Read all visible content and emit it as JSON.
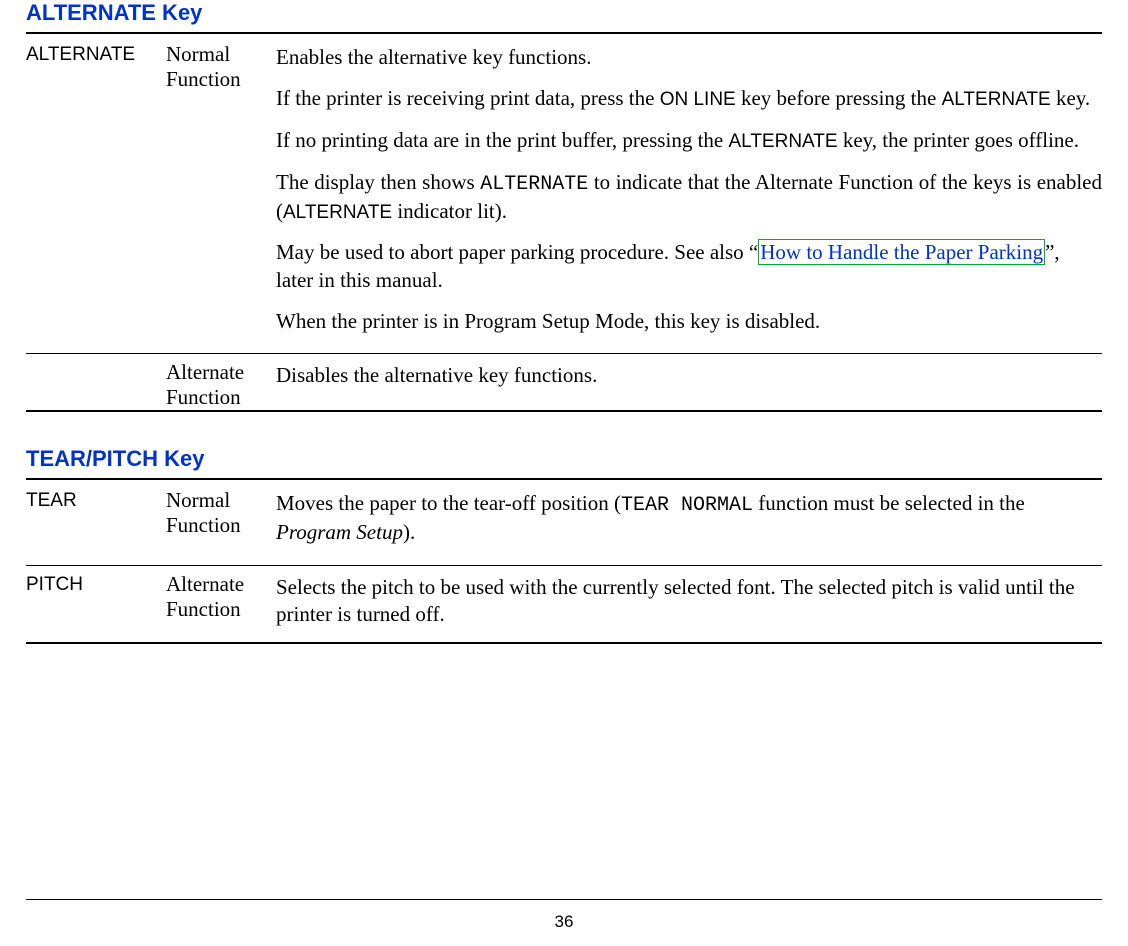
{
  "page_number": "36",
  "sections": [
    {
      "title": "ALTERNATE Key",
      "rows": [
        {
          "key": "ALTERNATE",
          "func": "Normal Function",
          "desc": [
            {
              "segments": [
                {
                  "t": "Enables the alternative key functions."
                }
              ]
            },
            {
              "segments": [
                {
                  "t": "If the printer is receiving print data, press the "
                },
                {
                  "t": "ON LINE",
                  "cls": "sans-inline"
                },
                {
                  "t": " key before pressing the "
                },
                {
                  "t": "ALTERNATE",
                  "cls": "sans-inline"
                },
                {
                  "t": " key."
                }
              ]
            },
            {
              "segments": [
                {
                  "t": "If no printing data are in the print buffer, pressing the "
                },
                {
                  "t": "ALTERNATE",
                  "cls": "sans-inline"
                },
                {
                  "t": " key, the printer goes offline."
                }
              ]
            },
            {
              "just": true,
              "segments": [
                {
                  "t": "The display then shows "
                },
                {
                  "t": "ALTERNATE",
                  "cls": "mono-inline"
                },
                {
                  "t": "  to indicate that the Alternate Function of the keys is enabled ("
                },
                {
                  "t": "ALTERNATE",
                  "cls": "sans-inline"
                },
                {
                  "t": " indicator lit)."
                }
              ]
            },
            {
              "segments": [
                {
                  "t": "May be used to abort paper parking procedure. See also “"
                },
                {
                  "t": "How to Handle the Paper Parking",
                  "link": true
                },
                {
                  "t": "”, later in this manual."
                }
              ]
            },
            {
              "segments": [
                {
                  "t": "When the printer is in Program Setup Mode, this key is disabled."
                }
              ]
            }
          ]
        },
        {
          "key": "",
          "func": "Alternate Function",
          "desc": [
            {
              "segments": [
                {
                  "t": "Disables the alternative key functions."
                }
              ]
            }
          ]
        }
      ]
    },
    {
      "title": "TEAR/PITCH Key",
      "rows": [
        {
          "key": "TEAR",
          "func": "Normal Function",
          "desc": [
            {
              "segments": [
                {
                  "t": "Moves the paper to the  tear-off position ("
                },
                {
                  "t": "TEAR NORMAL",
                  "cls": "mono-inline"
                },
                {
                  "t": " function must be selected in the "
                },
                {
                  "t": "Program Setup",
                  "cls": "italic"
                },
                {
                  "t": ")."
                }
              ]
            }
          ]
        },
        {
          "key": "PITCH",
          "func": "Alternate Function",
          "desc": [
            {
              "segments": [
                {
                  "t": "Selects the pitch to be used with the currently selected font. The selected pitch is valid until the printer is turned off."
                }
              ]
            }
          ]
        }
      ]
    }
  ]
}
